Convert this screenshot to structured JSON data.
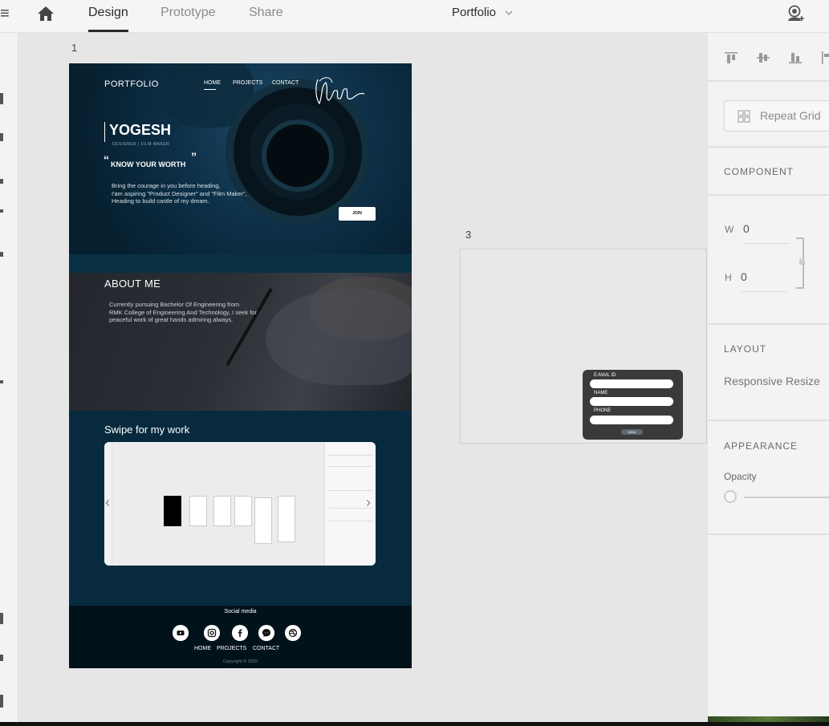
{
  "topbar": {
    "tabs": [
      {
        "label": "Design",
        "active": true
      },
      {
        "label": "Prototype",
        "active": false
      },
      {
        "label": "Share",
        "active": false
      }
    ],
    "document_title": "Portfolio"
  },
  "artboards": {
    "a1_label": "1",
    "a3_label": "3"
  },
  "portfolio": {
    "logo": "PORTFOLIO",
    "nav": [
      "HOME",
      "PROJECTS",
      "CONTACT"
    ],
    "name": "YOGESH",
    "subtitle": "DESIGNER | FILM MAKER",
    "quote_open": "“",
    "quote_close": "”",
    "tagline": "KNOW YOUR WORTH",
    "intro": [
      "Bring the courage in you before heading,",
      "I'am aspiring \"Product Designer\" and \"Film Maker\",",
      "Heading to build castle of my dream."
    ],
    "join_label": "JOIN",
    "about_title": "ABOUT ME",
    "about_text": [
      "Currently pursuing Bachelor Of Engineering from",
      "RMK College of Engineering And Technology, I seek for",
      "peaceful work of great hands admiring always."
    ],
    "work_title": "Swipe for my work",
    "social_title": "Social media",
    "social_icons": [
      "youtube-icon",
      "instagram-icon",
      "facebook-icon",
      "messenger-icon",
      "dribbble-icon"
    ],
    "footer_nav": [
      "HOME",
      "PROJECTS",
      "CONTACT"
    ],
    "copyright": "Copyright © 2020"
  },
  "contact_form": {
    "fields": [
      "E-MAIL ID",
      "NAME",
      "PHONE"
    ],
    "button": "SEND"
  },
  "right_panel": {
    "repeat_grid": "Repeat Grid",
    "component_heading": "COMPONENT",
    "w_label": "W",
    "w_value": "0",
    "h_label": "H",
    "h_value": "0",
    "layout_heading": "LAYOUT",
    "responsive_resize": "Responsive Resize",
    "appearance_heading": "APPEARANCE",
    "opacity_label": "Opacity"
  }
}
